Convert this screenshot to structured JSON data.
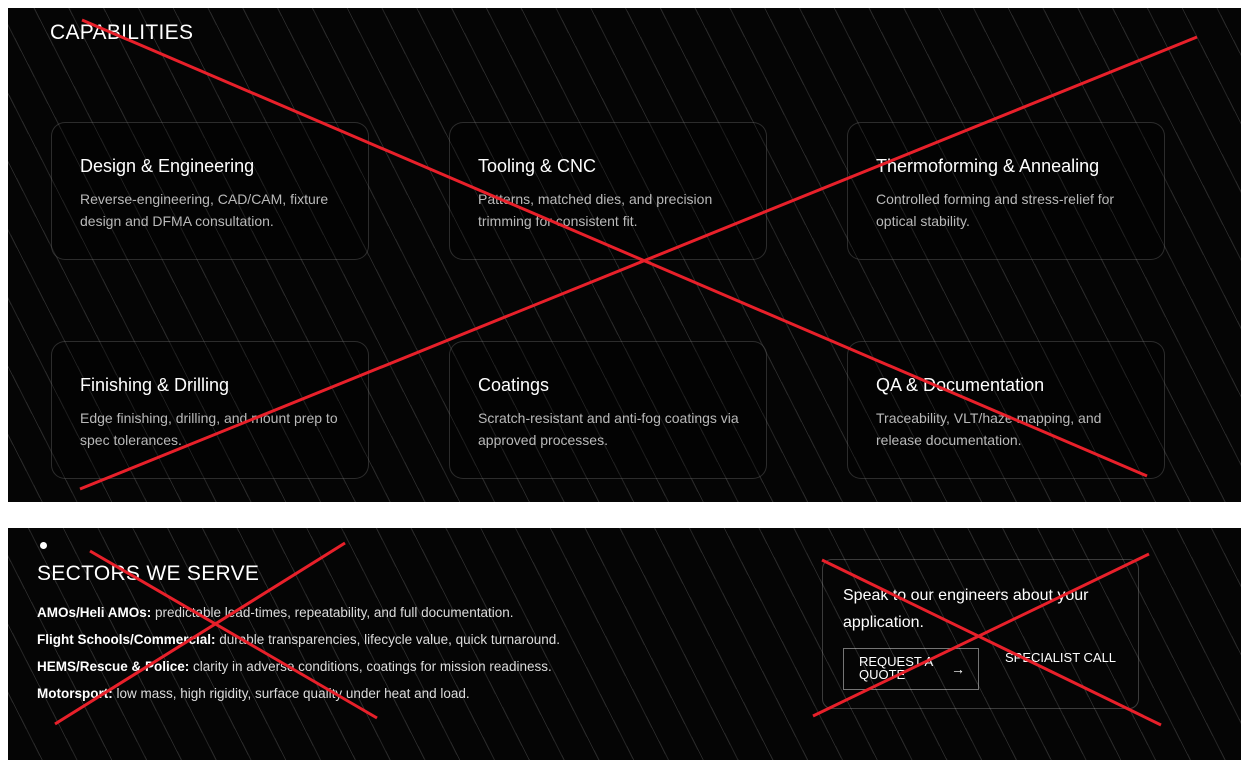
{
  "capabilities": {
    "title": "CAPABILITIES",
    "cards": [
      {
        "title": "Design & Engineering",
        "desc": "Reverse-engineering, CAD/CAM, fixture design and DFMA consultation."
      },
      {
        "title": "Tooling & CNC",
        "desc": "Patterns, matched dies, and precision trimming for consistent fit."
      },
      {
        "title": "Thermoforming & Annealing",
        "desc": "Controlled forming and stress-relief for optical stability."
      },
      {
        "title": "Finishing & Drilling",
        "desc": "Edge finishing, drilling, and mount prep to spec tolerances."
      },
      {
        "title": "Coatings",
        "desc": "Scratch-resistant and anti-fog coatings via approved processes."
      },
      {
        "title": "QA & Documentation",
        "desc": "Traceability, VLT/haze mapping, and release documentation."
      }
    ]
  },
  "sectors": {
    "title": "SECTORS WE SERVE",
    "items": [
      {
        "label": "AMOs/Heli AMOs:",
        "text": " predictable lead-times, repeatability, and full documentation."
      },
      {
        "label": "Flight Schools/Commercial:",
        "text": " durable transparencies, lifecycle value, quick turnaround."
      },
      {
        "label": "HEMS/Rescue & Police:",
        "text": " clarity in adverse conditions, coatings for mission readiness."
      },
      {
        "label": "Motorsport:",
        "text": " low mass, high rigidity, surface quality under heat and load."
      }
    ]
  },
  "cta": {
    "text": "Speak to our engineers about your application.",
    "quote_label": "REQUEST A QUOTE",
    "arrow_icon": "arrow-right-icon",
    "specialist_label": "SPECIALIST CALL"
  },
  "colors": {
    "background": "#050505",
    "text": "#ffffff",
    "muted_text": "#b9b9b9",
    "cross_mark": "#e8202a"
  }
}
